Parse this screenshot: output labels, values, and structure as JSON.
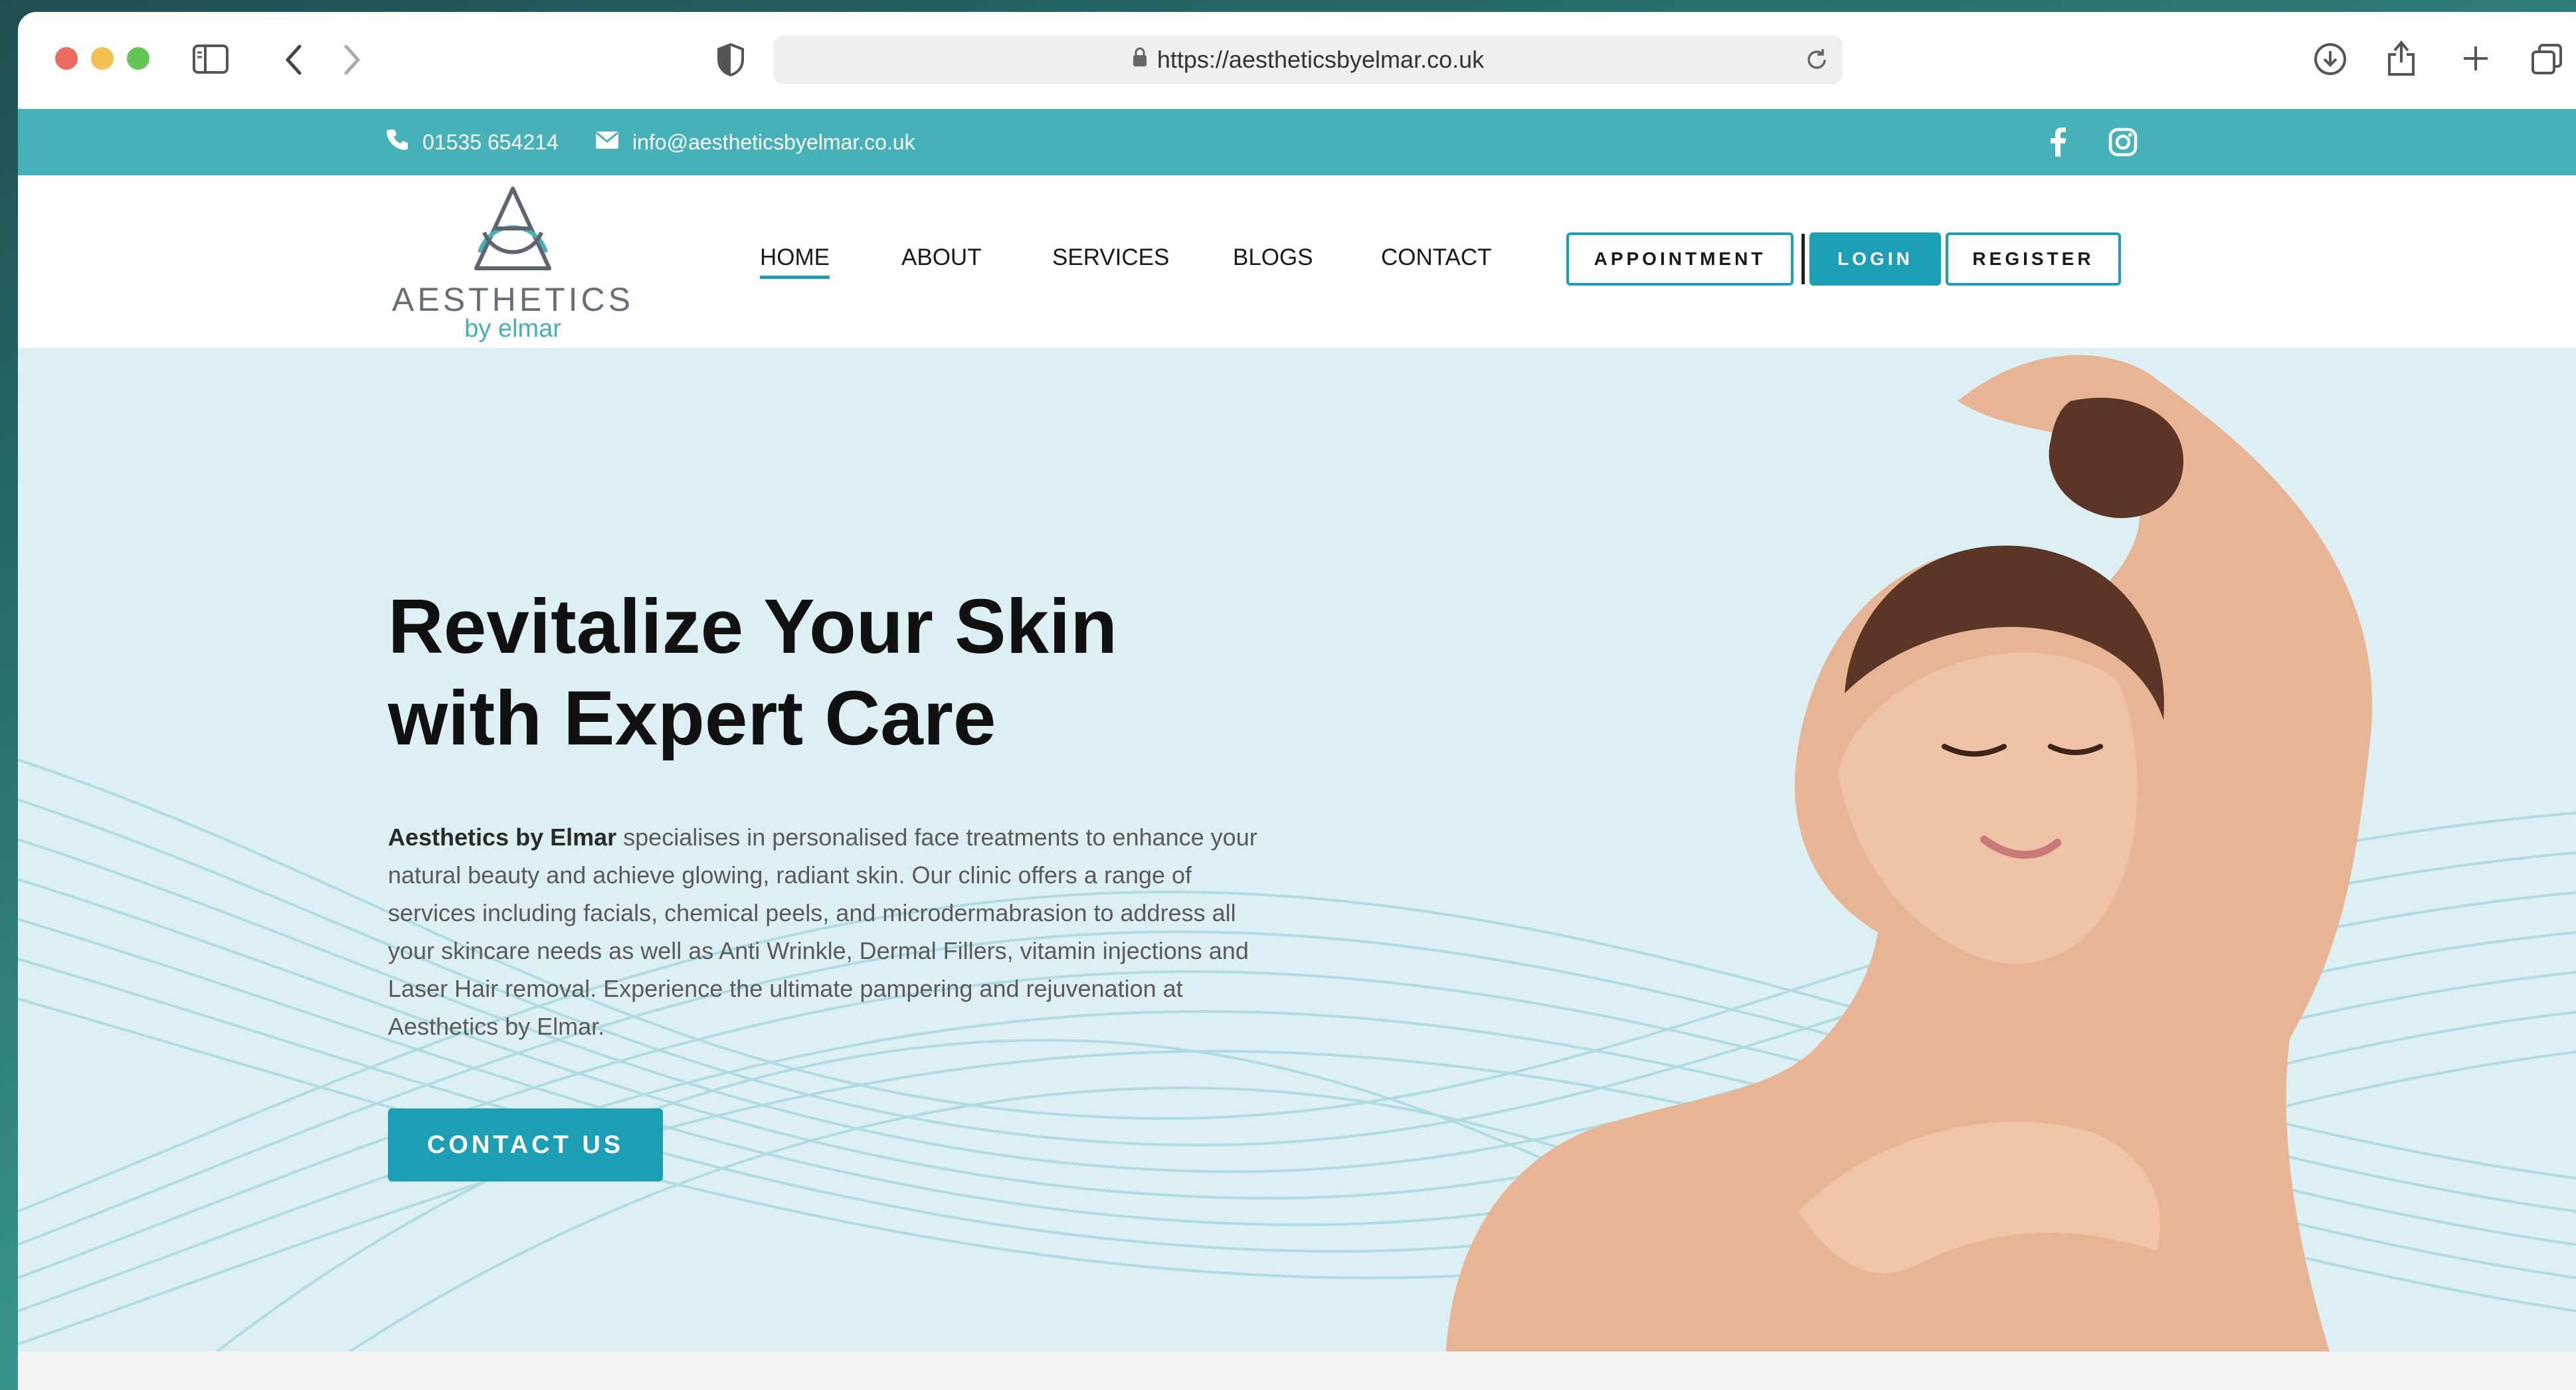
{
  "browser": {
    "url": "https://aestheticsbyelmar.co.uk"
  },
  "topbar": {
    "phone": "01535 654214",
    "email": "info@aestheticsbyelmar.co.uk"
  },
  "logo": {
    "line1": "AESTHETICS",
    "line2": "by elmar"
  },
  "nav": {
    "items": [
      "HOME",
      "ABOUT",
      "SERVICES",
      "BLOGS",
      "CONTACT"
    ],
    "active": "HOME"
  },
  "header_buttons": {
    "appointment": "APPOINTMENT",
    "login": "LOGIN",
    "register": "REGISTER"
  },
  "hero": {
    "title_line1": "Revitalize Your Skin",
    "title_line2": "with Expert Care",
    "body_bold": "Aesthetics by Elmar",
    "body_rest": " specialises in personalised face treatments to enhance your natural beauty and achieve glowing, radiant skin. Our clinic offers a range of services including facials, chemical peels, and microdermabrasion to address all your skincare needs as well as Anti Wrinkle, Dermal Fillers, vitamin injections and Laser Hair removal. Experience the ultimate pampering and rejuvenation at Aesthetics by Elmar.",
    "cta": "CONTACT US"
  },
  "colors": {
    "brand_teal": "#1b9fb4",
    "topbar_teal": "#44b2b8",
    "hero_bg": "#dcf0f3"
  },
  "icons": [
    "sidebar-icon",
    "back-icon",
    "forward-icon",
    "shield-icon",
    "lock-icon",
    "reload-icon",
    "download-icon",
    "share-icon",
    "plus-icon",
    "tabs-icon",
    "phone-icon",
    "mail-icon",
    "facebook-icon",
    "instagram-icon"
  ]
}
